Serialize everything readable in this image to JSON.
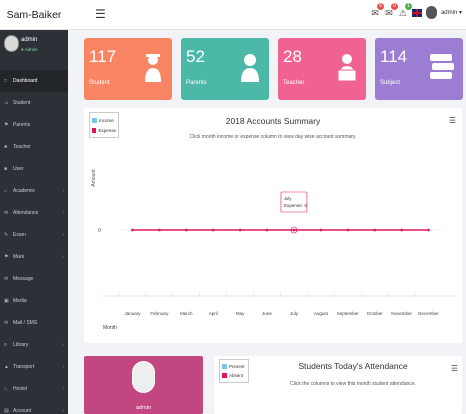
{
  "app": {
    "brand": "Sam-Baiker"
  },
  "topbar": {
    "user_label": "admin ▾",
    "badges": [
      "6",
      "0",
      "1"
    ],
    "badge_colors": [
      "#e05353",
      "#e05353",
      "#4caf50"
    ]
  },
  "sidebar": {
    "profile": {
      "name": "admin",
      "role": "● Admin"
    },
    "items": [
      {
        "label": "Dashboard",
        "icon": "dashboard-icon",
        "glyph": "□",
        "chevron": false,
        "active": true
      },
      {
        "label": "Student",
        "icon": "student-icon",
        "glyph": "☺",
        "chevron": false,
        "active": false
      },
      {
        "label": "Parents",
        "icon": "parents-icon",
        "glyph": "⚑",
        "chevron": false,
        "active": false
      },
      {
        "label": "Teacher",
        "icon": "teacher-icon",
        "glyph": "♣",
        "chevron": false,
        "active": false
      },
      {
        "label": "User",
        "icon": "user-icon",
        "glyph": "■",
        "chevron": false,
        "active": false
      },
      {
        "label": "Academic",
        "icon": "academic-icon",
        "glyph": "⌂",
        "chevron": true,
        "active": false
      },
      {
        "label": "Attendance",
        "icon": "attendance-icon",
        "glyph": "✉",
        "chevron": true,
        "active": false
      },
      {
        "label": "Exam",
        "icon": "exam-icon",
        "glyph": "✎",
        "chevron": true,
        "active": false
      },
      {
        "label": "Mark",
        "icon": "mark-icon",
        "glyph": "⚑",
        "chevron": true,
        "active": false
      },
      {
        "label": "Message",
        "icon": "message-icon",
        "glyph": "✉",
        "chevron": false,
        "active": false
      },
      {
        "label": "Media",
        "icon": "media-icon",
        "glyph": "▣",
        "chevron": false,
        "active": false
      },
      {
        "label": "Mail / SMS",
        "icon": "mail-icon",
        "glyph": "✉",
        "chevron": false,
        "active": false
      },
      {
        "label": "Library",
        "icon": "library-icon",
        "glyph": "≡",
        "chevron": true,
        "active": false
      },
      {
        "label": "Transport",
        "icon": "transport-icon",
        "glyph": "▲",
        "chevron": true,
        "active": false
      },
      {
        "label": "Hostel",
        "icon": "hostel-icon",
        "glyph": "⌂",
        "chevron": true,
        "active": false
      },
      {
        "label": "Account",
        "icon": "account-icon",
        "glyph": "▤",
        "chevron": true,
        "active": false
      }
    ]
  },
  "stats": [
    {
      "value": "117",
      "label": "Student",
      "color": "#fa8564",
      "icon": "graduate-icon"
    },
    {
      "value": "52",
      "label": "Parents",
      "color": "#4cb8a8",
      "icon": "user-icon"
    },
    {
      "value": "28",
      "label": "Teacher",
      "color": "#f06292",
      "icon": "teacher-icon"
    },
    {
      "value": "114",
      "label": "Subject",
      "color": "#9c7dd4",
      "icon": "books-icon"
    }
  ],
  "summary": {
    "title": "2018 Accounts Summary",
    "subtitle": "Click month income or expense column to view day wise account summary.",
    "tooltip_month": "July",
    "tooltip_text": "Expense: 0"
  },
  "chart_data": {
    "type": "line",
    "title": "2018 Accounts Summary",
    "xlabel": "Month",
    "ylabel": "Amount",
    "categories": [
      "January",
      "February",
      "March",
      "April",
      "May",
      "June",
      "July",
      "August",
      "September",
      "October",
      "November",
      "December"
    ],
    "series": [
      {
        "name": "Income",
        "color": "#7cc7e8",
        "values": [
          0,
          0,
          0,
          0,
          0,
          0,
          0,
          0,
          0,
          0,
          0,
          0
        ]
      },
      {
        "name": "Expense",
        "color": "#e0155d",
        "values": [
          0,
          0,
          0,
          0,
          0,
          0,
          0,
          0,
          0,
          0,
          0,
          0
        ]
      }
    ],
    "y_ticks": [
      "0"
    ],
    "legend": "top-left"
  },
  "profile_card": {
    "name": "admin"
  },
  "attendance": {
    "title": "Students Today's Attendance",
    "subtitle": "Click the columns to view this month student attendance.",
    "legend": [
      {
        "label": "Present",
        "color": "#7cc7e8"
      },
      {
        "label": "Absent",
        "color": "#e0155d"
      }
    ]
  }
}
